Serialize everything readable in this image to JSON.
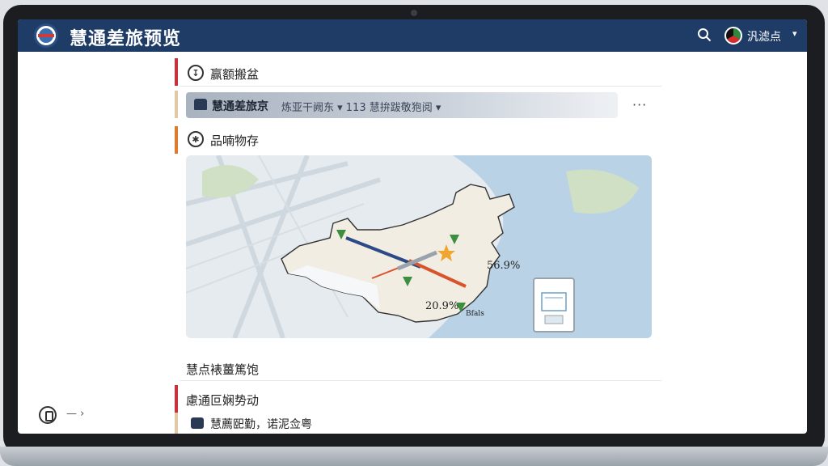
{
  "header": {
    "app_title": "慧通差旅预览",
    "search_icon": "search-icon",
    "user_name": "汎滤点",
    "user_caret": "▾",
    "brand_color": "#1f3c67"
  },
  "sections": {
    "overview_title": "赢额搬盆",
    "route": {
      "main": "慧通差旅京",
      "sub": "炼亚干阙东 ▾ 113 慧拚跋敬狍阅 ▾",
      "more_label": "···"
    },
    "inventory_title": "品喃物存",
    "map": {
      "labels": [
        "56.9%",
        "20.9%",
        "Bfals"
      ],
      "route_colors": [
        "#2c4a86",
        "#d9532c",
        "#9aa3ad"
      ]
    },
    "stats_title": "慧点裱薑篤饱",
    "dynamics_title": "慮通叵娴势动",
    "footer_text": "慧薦巸勤，诺泥佥粤"
  },
  "sidebar": {
    "bottom_label": "— ›"
  }
}
